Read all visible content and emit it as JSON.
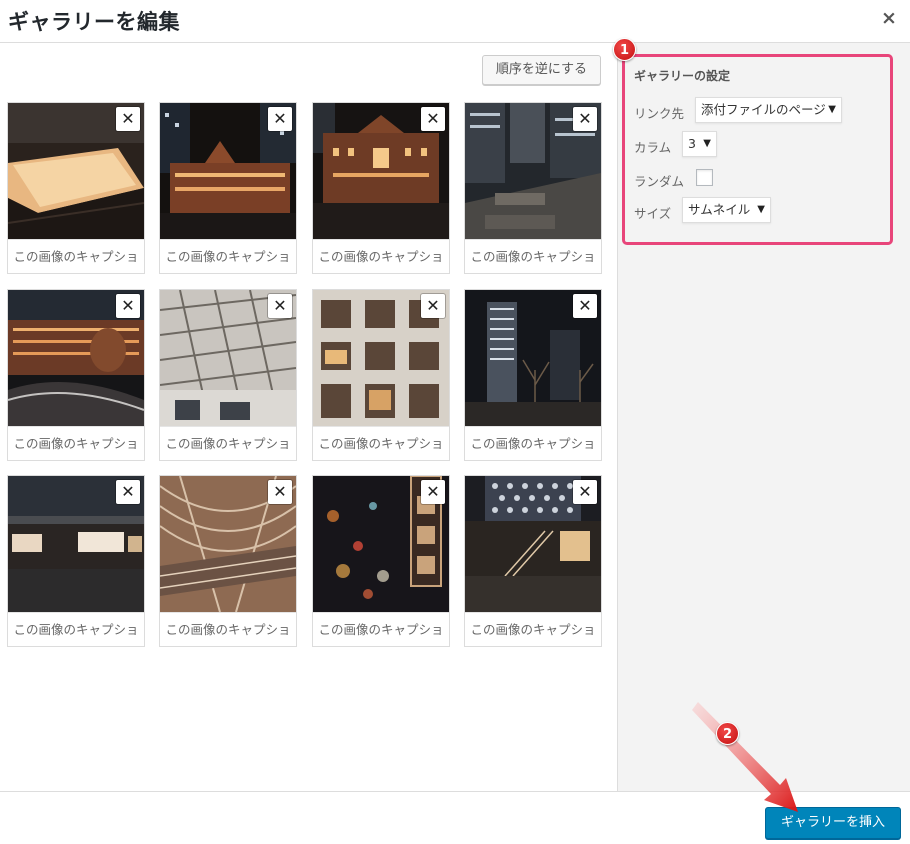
{
  "header": {
    "title": "ギャラリーを編集",
    "close_glyph": "×"
  },
  "toolbar": {
    "reverse_label": "順序を逆にする"
  },
  "gallery": {
    "remove_glyph": "✕",
    "items": [
      {
        "caption": "この画像のキャプショ"
      },
      {
        "caption": "この画像のキャプショ"
      },
      {
        "caption": "この画像のキャプショ"
      },
      {
        "caption": "この画像のキャプショ"
      },
      {
        "caption": "この画像のキャプショ"
      },
      {
        "caption": "この画像のキャプショ"
      },
      {
        "caption": "この画像のキャプショ"
      },
      {
        "caption": "この画像のキャプショ"
      },
      {
        "caption": "この画像のキャプショ"
      },
      {
        "caption": "この画像のキャプショ"
      },
      {
        "caption": "この画像のキャプショ"
      },
      {
        "caption": "この画像のキャプショ"
      }
    ]
  },
  "settings": {
    "title": "ギャラリーの設定",
    "link_label": "リンク先",
    "link_value": "添付ファイルのページ",
    "columns_label": "カラム",
    "columns_value": "3",
    "random_label": "ランダム",
    "random_checked": false,
    "size_label": "サイズ",
    "size_value": "サムネイル"
  },
  "footer": {
    "insert_label": "ギャラリーを挿入"
  },
  "annotations": {
    "badge1": "1",
    "badge2": "2",
    "highlight_color": "#e8457a",
    "badge_color": "#d11a1a"
  },
  "colors": {
    "primary_button": "#0085ba",
    "sidebar_bg": "#f3f3f3"
  }
}
